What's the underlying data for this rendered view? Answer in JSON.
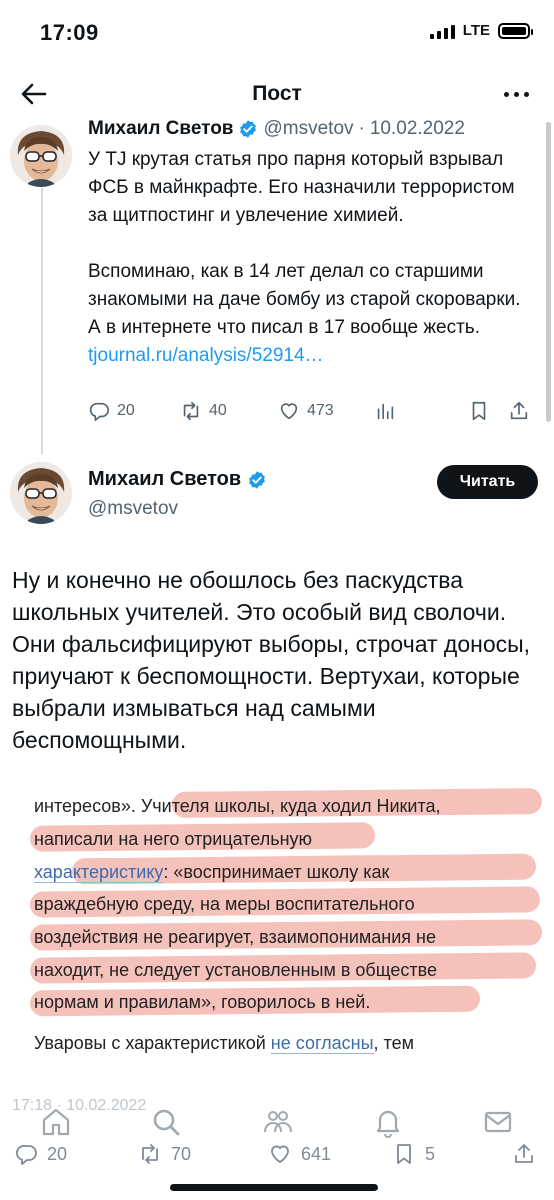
{
  "status_bar": {
    "time": "17:09",
    "network": "LTE"
  },
  "nav": {
    "title": "Пост"
  },
  "tweet1": {
    "author_name": "Михаил Светов",
    "handle": "@msvetov",
    "separator": "·",
    "date": "10.02.2022",
    "paragraph1": "У TJ крутая статья про парня который взрывал ФСБ в майнкрафте. Его назначили террористом за щитпостинг и увлечение химией.",
    "paragraph2": "Вспоминаю, как в 14 лет делал со старшими знакомыми на даче бомбу из старой скороварки. А в интернете что писал в 17 вообще жесть.",
    "link": "tjournal.ru/analysis/52914…",
    "replies": "20",
    "retweets": "40",
    "likes": "473"
  },
  "tweet2": {
    "author_name": "Михаил Светов",
    "handle": "@msvetov",
    "follow_label": "Читать",
    "body": "Ну и конечно не обошлось без паскудства школьных учителей. Это особый вид сволочи. Они фальсифицируют выборы, строчат доносы, приучают к беспомощности. Вертухаи, которые выбрали измываться над самыми беспомощными.",
    "timestamp": "17:18 · 10.02.2022",
    "replies": "20",
    "retweets": "70",
    "likes": "641",
    "bookmarks": "5"
  },
  "article_image": {
    "line1": "интересов». Учителя школы, куда ходил Никита,",
    "line2": "написали на него отрицательную",
    "line3_link": "характеристику",
    "line3_rest": ": «воспринимает школу как",
    "line4": "враждебную среду, на меры воспитательного",
    "line5": "воздействия не реагирует, взаимопонимания не",
    "line6": "находит, не следует установленным в обществе",
    "line7": "нормам и правилам», говорилось в ней.",
    "line8_pre": "Уваровы с характеристикой ",
    "line8_link": "не согласны",
    "line8_post": ", тем"
  },
  "colors": {
    "link": "#1d9bf0",
    "verified": "#1d9bf0",
    "highlight": "#e87668",
    "secondary_text": "#536471"
  },
  "icons": [
    "back-arrow-icon",
    "more-icon",
    "verified-icon",
    "reply-icon",
    "retweet-icon",
    "like-icon",
    "views-icon",
    "bookmark-icon",
    "share-icon",
    "home-icon",
    "search-icon",
    "communities-icon",
    "notifications-icon",
    "messages-icon"
  ]
}
